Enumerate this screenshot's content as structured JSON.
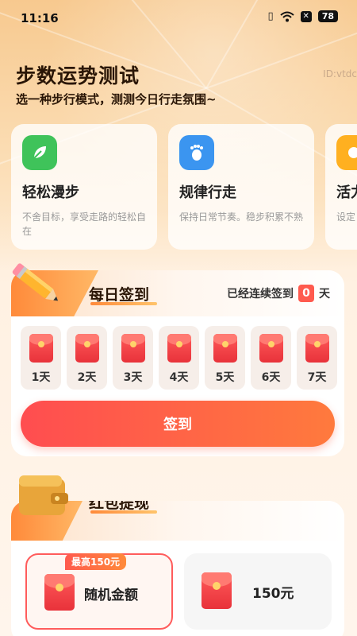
{
  "status": {
    "time": "11:16",
    "battery": "78"
  },
  "header": {
    "title": "步数运势测试",
    "subtitle": "选一种步行模式，测测今日行走氛围~",
    "id_tag": "ID:vtdc"
  },
  "modes": [
    {
      "name": "轻松漫步",
      "desc": "不舍目标，享受走路的轻松自在",
      "icon": "leaf-icon",
      "color": "#3fc35a"
    },
    {
      "name": "规律行走",
      "desc": "保持日常节奏。稳步积累不熟",
      "icon": "footprints-icon",
      "color": "#3b95f0"
    },
    {
      "name": "活力",
      "desc": "设定日常",
      "icon": "energy-icon",
      "color": "#ffb020"
    }
  ],
  "checkin": {
    "title": "每日签到",
    "streak_prefix": "已经连续签到",
    "streak_count": "0",
    "streak_suffix": "天",
    "days": [
      "1天",
      "2天",
      "3天",
      "4天",
      "5天",
      "6天",
      "7天"
    ],
    "button_label": "签到"
  },
  "withdraw": {
    "title": "红包提现",
    "options": [
      {
        "label": "随机金额",
        "badge": "最高150元",
        "selected": true
      },
      {
        "label": "150元",
        "selected": false
      }
    ]
  },
  "colors": {
    "accent": "#ff5a4e",
    "orange": "#ff8a3a"
  }
}
